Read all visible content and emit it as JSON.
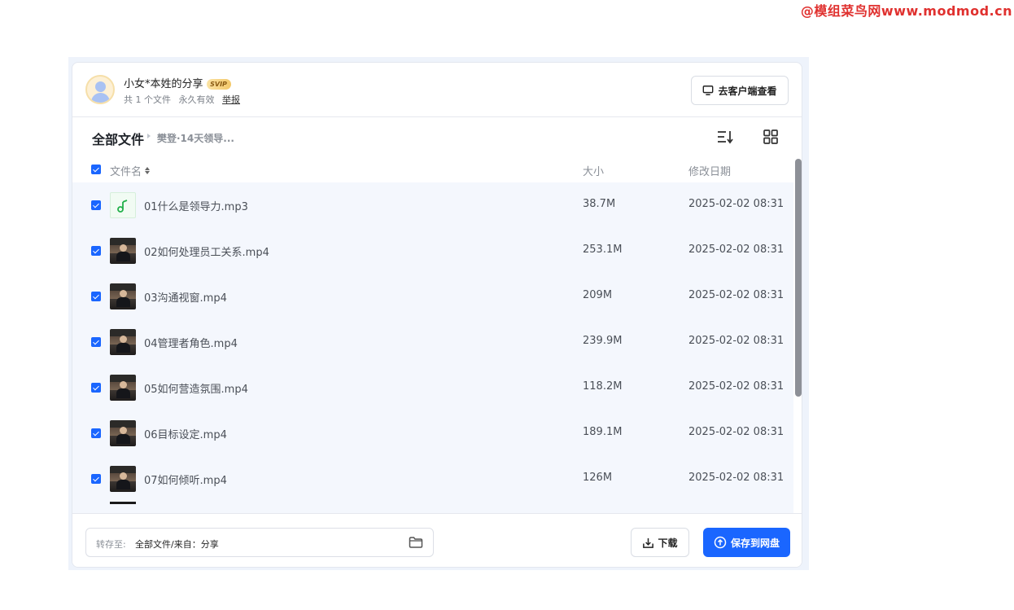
{
  "watermark": "@模组菜鸟网www.modmod.cn",
  "header": {
    "sharer": "小女*本姓的分享",
    "badge": "SVIP",
    "file_count": "共 1 个文件",
    "validity": "永久有效",
    "report": "举报",
    "client_button": "去客户端查看"
  },
  "toolbar": {
    "crumb_root": "全部文件",
    "crumb_current": "樊登·14天领导..."
  },
  "columns": {
    "name": "文件名",
    "size": "大小",
    "date": "修改日期"
  },
  "files": [
    {
      "name": "01什么是领导力.mp3",
      "size": "38.7M",
      "date": "2025-02-02 08:31",
      "type": "audio"
    },
    {
      "name": "02如何处理员工关系.mp4",
      "size": "253.1M",
      "date": "2025-02-02 08:31",
      "type": "video"
    },
    {
      "name": "03沟通视窗.mp4",
      "size": "209M",
      "date": "2025-02-02 08:31",
      "type": "video"
    },
    {
      "name": "04管理者角色.mp4",
      "size": "239.9M",
      "date": "2025-02-02 08:31",
      "type": "video"
    },
    {
      "name": "05如何营造氛围.mp4",
      "size": "118.2M",
      "date": "2025-02-02 08:31",
      "type": "video"
    },
    {
      "name": "06目标设定.mp4",
      "size": "189.1M",
      "date": "2025-02-02 08:31",
      "type": "video"
    },
    {
      "name": "07如何倾听.mp4",
      "size": "126M",
      "date": "2025-02-02 08:31",
      "type": "video"
    }
  ],
  "footer": {
    "save_to_label": "转存至:",
    "save_to_value": "全部文件/来自：分享",
    "download": "下载",
    "save_to_disk": "保存到网盘"
  },
  "colors": {
    "accent": "#1a66ff",
    "list_bg": "#f4f7fd",
    "watermark": "#e0312f"
  },
  "icons": [
    "monitor-icon",
    "sort-icon",
    "grid-view-icon",
    "music-note-icon",
    "folder-icon",
    "download-icon",
    "cloud-upload-icon"
  ]
}
